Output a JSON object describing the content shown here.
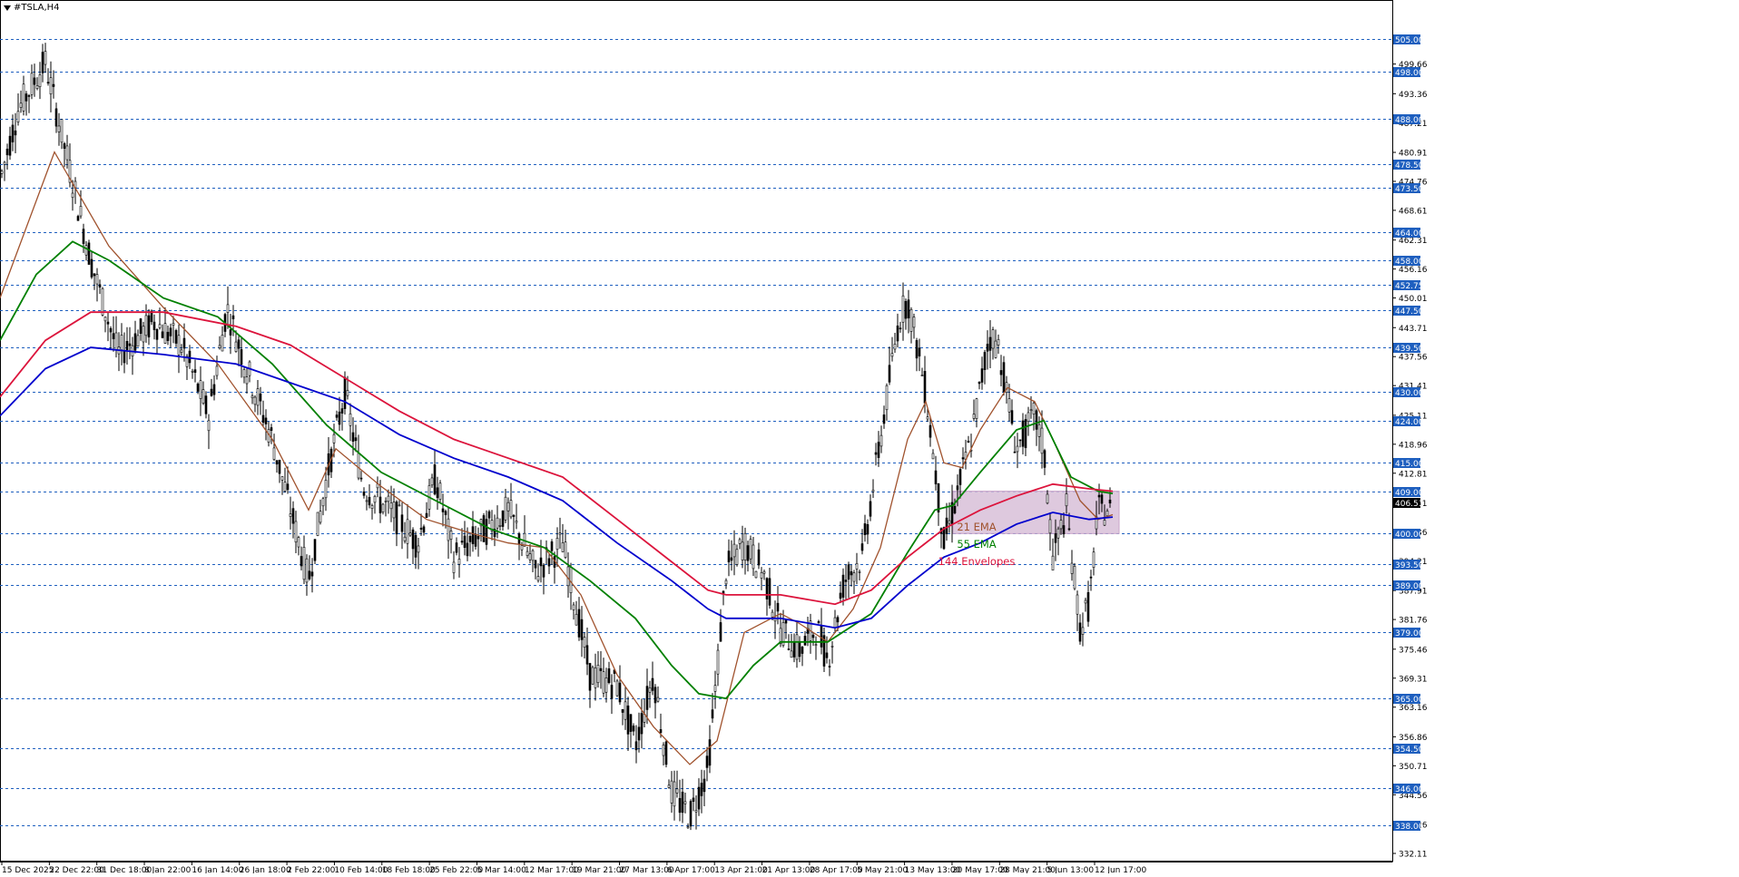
{
  "symbol_title": "#TSLA,H4",
  "chart_data": {
    "type": "candlestick",
    "title": "#TSLA,H4",
    "ylim": [
      332.11,
      509.5
    ],
    "y_tick_labels": [
      "499.66",
      "493.36",
      "487.21",
      "480.91",
      "474.76",
      "468.61",
      "462.31",
      "456.16",
      "450.01",
      "443.71",
      "437.56",
      "431.41",
      "425.11",
      "418.96",
      "412.81",
      "406.51",
      "400.36",
      "394.21",
      "387.91",
      "381.76",
      "375.46",
      "369.31",
      "363.16",
      "356.86",
      "350.71",
      "344.56",
      "338.26",
      "332.11"
    ],
    "x_tick_labels": [
      "15 Dec 2025",
      "22 Dec 22:00",
      "31 Dec 18:00",
      "8 Jan 22:00",
      "16 Jan 14:00",
      "26 Jan 18:00",
      "2 Feb 22:00",
      "10 Feb 14:00",
      "18 Feb 18:00",
      "25 Feb 22:00",
      "5 Mar 14:00",
      "12 Mar 17:00",
      "19 Mar 21:00",
      "27 Mar 13:00",
      "6 Apr 17:00",
      "13 Apr 21:00",
      "21 Apr 13:00",
      "28 Apr 17:00",
      "5 May 21:00",
      "13 May 13:00",
      "20 May 17:00",
      "28 May 21:00",
      "5 Jun 13:00",
      "12 Jun 17:00"
    ],
    "levels": [
      {
        "value": "505.00"
      },
      {
        "value": "498.00"
      },
      {
        "value": "488.00"
      },
      {
        "value": "478.50"
      },
      {
        "value": "473.50"
      },
      {
        "value": "464.00"
      },
      {
        "value": "458.00"
      },
      {
        "value": "452.75"
      },
      {
        "value": "447.50"
      },
      {
        "value": "439.50"
      },
      {
        "value": "430.00"
      },
      {
        "value": "424.00"
      },
      {
        "value": "415.00"
      },
      {
        "value": "409.00"
      },
      {
        "value": "400.00"
      },
      {
        "value": "393.50"
      },
      {
        "value": "389.00"
      },
      {
        "value": "379.00"
      },
      {
        "value": "365.00"
      },
      {
        "value": "354.50"
      },
      {
        "value": "346.00"
      },
      {
        "value": "338.00"
      }
    ],
    "current_price": "406.51",
    "zone": {
      "from_date": "20 May 17:00",
      "low": 400.0,
      "high": 409.0
    },
    "series": [
      {
        "name": "21 EMA",
        "color": "#a0522d",
        "points": [
          [
            0,
            450
          ],
          [
            60,
            481
          ],
          [
            120,
            461
          ],
          [
            180,
            448
          ],
          [
            240,
            436
          ],
          [
            300,
            420
          ],
          [
            340,
            405
          ],
          [
            370,
            418
          ],
          [
            420,
            410
          ],
          [
            470,
            403
          ],
          [
            520,
            400
          ],
          [
            560,
            398
          ],
          [
            600,
            397
          ],
          [
            640,
            387
          ],
          [
            680,
            370
          ],
          [
            720,
            359
          ],
          [
            760,
            351
          ],
          [
            790,
            356
          ],
          [
            820,
            379
          ],
          [
            860,
            383
          ],
          [
            880,
            381
          ],
          [
            912,
            377
          ],
          [
            940,
            384
          ],
          [
            970,
            397
          ],
          [
            1000,
            420
          ],
          [
            1020,
            428
          ],
          [
            1040,
            415
          ],
          [
            1060,
            414
          ],
          [
            1080,
            422
          ],
          [
            1110,
            431
          ],
          [
            1140,
            428
          ],
          [
            1160,
            420
          ],
          [
            1190,
            407
          ],
          [
            1210,
            403
          ],
          [
            1226,
            404
          ]
        ]
      },
      {
        "name": "55 EMA",
        "color": "#008000",
        "points": [
          [
            0,
            441
          ],
          [
            40,
            455
          ],
          [
            80,
            462
          ],
          [
            120,
            458
          ],
          [
            180,
            450
          ],
          [
            240,
            446
          ],
          [
            300,
            436
          ],
          [
            360,
            423
          ],
          [
            420,
            413
          ],
          [
            480,
            407
          ],
          [
            540,
            401
          ],
          [
            600,
            397
          ],
          [
            650,
            390
          ],
          [
            700,
            382
          ],
          [
            740,
            372
          ],
          [
            770,
            366
          ],
          [
            800,
            365
          ],
          [
            830,
            372
          ],
          [
            860,
            377
          ],
          [
            912,
            377
          ],
          [
            960,
            383
          ],
          [
            1000,
            396
          ],
          [
            1030,
            405
          ],
          [
            1050,
            406
          ],
          [
            1080,
            413
          ],
          [
            1120,
            422
          ],
          [
            1150,
            424
          ],
          [
            1180,
            412
          ],
          [
            1210,
            409
          ],
          [
            1226,
            408.5
          ]
        ]
      },
      {
        "name": "144 Envelopes",
        "color": "#dc143c",
        "points": [
          [
            0,
            429
          ],
          [
            50,
            441
          ],
          [
            100,
            447
          ],
          [
            180,
            447
          ],
          [
            260,
            444
          ],
          [
            320,
            440
          ],
          [
            380,
            433
          ],
          [
            440,
            426
          ],
          [
            500,
            420
          ],
          [
            560,
            416
          ],
          [
            620,
            412
          ],
          [
            680,
            403
          ],
          [
            740,
            394
          ],
          [
            780,
            388
          ],
          [
            800,
            387
          ],
          [
            860,
            387
          ],
          [
            920,
            385
          ],
          [
            960,
            388
          ],
          [
            1000,
            395
          ],
          [
            1040,
            401
          ],
          [
            1080,
            405
          ],
          [
            1120,
            408
          ],
          [
            1160,
            410.5
          ],
          [
            1200,
            409.5
          ],
          [
            1226,
            409
          ]
        ]
      },
      {
        "name": "",
        "color": "#0000cd",
        "points": [
          [
            0,
            425
          ],
          [
            50,
            435
          ],
          [
            100,
            439.5
          ],
          [
            180,
            438
          ],
          [
            260,
            436
          ],
          [
            320,
            432
          ],
          [
            380,
            428
          ],
          [
            440,
            421
          ],
          [
            500,
            416
          ],
          [
            560,
            412
          ],
          [
            620,
            407
          ],
          [
            680,
            398
          ],
          [
            740,
            390
          ],
          [
            780,
            384
          ],
          [
            800,
            382
          ],
          [
            860,
            382
          ],
          [
            920,
            380
          ],
          [
            960,
            382
          ],
          [
            1000,
            389
          ],
          [
            1040,
            395
          ],
          [
            1080,
            398
          ],
          [
            1120,
            402
          ],
          [
            1160,
            404.5
          ],
          [
            1200,
            403
          ],
          [
            1226,
            403.5
          ]
        ]
      }
    ],
    "legend": [
      {
        "label": "21 EMA",
        "color": "#a0522d"
      },
      {
        "label": "55 EMA",
        "color": "#008000"
      },
      {
        "label": "144 Envelopes",
        "color": "#dc143c"
      }
    ],
    "grid": true
  }
}
